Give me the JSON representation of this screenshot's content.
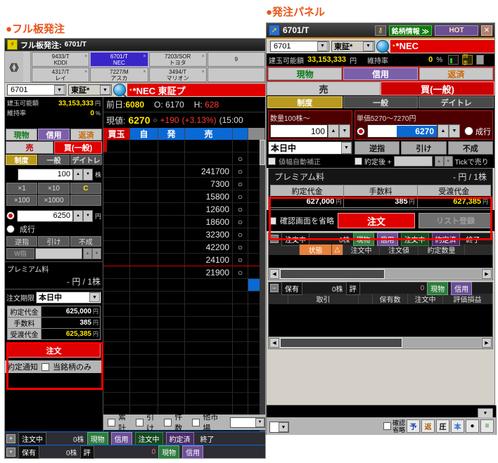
{
  "captions": {
    "left": "●フル板発注",
    "right": "●発注パネル"
  },
  "left_panel": {
    "titlebar": {
      "icon": "app-icon",
      "title": "フル板発注:",
      "symbol": "6701/T"
    },
    "tabs": [
      {
        "code": "9433/T",
        "name": "KDDI",
        "selected": false
      },
      {
        "code": "6701/T",
        "name": "NEC",
        "selected": true
      },
      {
        "code": "7203/SOR",
        "name": "トヨタ",
        "selected": false
      },
      {
        "code": "9",
        "name": "",
        "selected": false
      },
      {
        "code": "4317/T",
        "name": "レイ",
        "selected": false
      },
      {
        "code": "7227/M",
        "name": "アスカ",
        "selected": false
      },
      {
        "code": "3494/T",
        "name": "マリオン",
        "selected": false
      },
      {
        "code": "",
        "name": "",
        "selected": false
      }
    ],
    "nav": {
      "prev": "《",
      "next": "》"
    },
    "symbol_row": {
      "code_value": "6701",
      "market_value": "東証*",
      "name_band": "*NEC 東証プ"
    },
    "account": {
      "margin_label": "建玉可能額",
      "margin_value": "33,153,333",
      "margin_unit": "円",
      "ratio_label": "維持率",
      "ratio_value": "0",
      "ratio_unit": "%"
    },
    "quote": {
      "prev_label": "前日:",
      "prev_value": "6080",
      "open_label": "O:",
      "open_value": "6170",
      "high_label": "H:",
      "high_value": "628",
      "cur_label": "現値:",
      "cur_value": "6270",
      "mark": "○",
      "change": "+190",
      "change_pct": "(+3.13%)",
      "time": "(15:00"
    },
    "order": {
      "seg_product": [
        "現物",
        "信用",
        "返済"
      ],
      "seg_side": [
        "売",
        "買(一般)"
      ],
      "seg_type": [
        "制度",
        "一般",
        "デイトレ"
      ],
      "qty_value": "100",
      "qty_unit": "株",
      "mult_buttons": [
        "×1",
        "×10",
        "C",
        "×100",
        "×1000",
        ""
      ],
      "price_value": "6250",
      "price_unit": "円",
      "market_label": "成行",
      "cond_buttons": [
        "逆指",
        "引け",
        "不成"
      ],
      "w_label": "W指",
      "premium_label": "プレミアム料",
      "premium_value": "- 円 / 1株",
      "term_label": "注文期限",
      "term_value": "本日中",
      "summary": [
        {
          "key": "約定代金",
          "value": "625,000",
          "unit": "円",
          "highlight": false
        },
        {
          "key": "手数料",
          "value": "385",
          "unit": "円",
          "highlight": false
        },
        {
          "key": "受渡代金",
          "value": "625,385",
          "unit": "円",
          "highlight": true
        }
      ],
      "submit_label": "注文",
      "notify_label": "約定通知",
      "notify_option": "当銘柄のみ"
    },
    "board": {
      "headers": [
        "買玉",
        "自",
        "発",
        "売",
        "",
        ""
      ],
      "rows": [
        {
          "buy": "",
          "own": "",
          "sent": "",
          "sell": "",
          "price": "",
          "tail": ""
        },
        {
          "buy": "",
          "own": "",
          "sent": "",
          "sell": "",
          "price": "○",
          "tail": ""
        },
        {
          "buy": "",
          "own": "",
          "sent": "",
          "sell": "241700",
          "price": "○",
          "tail": ""
        },
        {
          "buy": "",
          "own": "",
          "sent": "",
          "sell": "7300",
          "price": "○",
          "tail": ""
        },
        {
          "buy": "",
          "own": "",
          "sent": "",
          "sell": "15800",
          "price": "○",
          "tail": ""
        },
        {
          "buy": "",
          "own": "",
          "sent": "",
          "sell": "12600",
          "price": "○",
          "tail": ""
        },
        {
          "buy": "",
          "own": "",
          "sent": "",
          "sell": "18600",
          "price": "○",
          "tail": ""
        },
        {
          "buy": "",
          "own": "",
          "sent": "",
          "sell": "32300",
          "price": "○",
          "tail": ""
        },
        {
          "buy": "",
          "own": "",
          "sent": "",
          "sell": "42200",
          "price": "○",
          "tail": ""
        },
        {
          "buy": "",
          "own": "",
          "sent": "",
          "sell": "24100",
          "price": "○",
          "tail": ""
        },
        {
          "buy": "",
          "own": "",
          "sent": "",
          "sell": "21900",
          "price": "○",
          "tail": "·"
        },
        {
          "buy": "",
          "own": "",
          "sent": "",
          "sell": "",
          "price": "",
          "tail": ""
        },
        {
          "buy": "",
          "own": "",
          "sent": "",
          "sell": "",
          "price": "",
          "tail": ""
        },
        {
          "buy": "",
          "own": "",
          "sent": "",
          "sell": "",
          "price": "",
          "tail": ""
        },
        {
          "buy": "",
          "own": "",
          "sent": "",
          "sell": "",
          "price": "",
          "tail": ""
        },
        {
          "buy": "",
          "own": "",
          "sent": "",
          "sell": "",
          "price": "",
          "tail": ""
        },
        {
          "buy": "",
          "own": "",
          "sent": "",
          "sell": "",
          "price": "",
          "tail": ""
        },
        {
          "buy": "",
          "own": "",
          "sent": "",
          "sell": "",
          "price": "",
          "tail": ""
        },
        {
          "buy": "",
          "own": "",
          "sent": "",
          "sell": "",
          "price": "",
          "tail": ""
        },
        {
          "buy": "",
          "own": "",
          "sent": "",
          "sell": "",
          "price": "",
          "tail": ""
        },
        {
          "buy": "",
          "own": "",
          "sent": "",
          "sell": "",
          "price": "",
          "tail": ""
        },
        {
          "buy": "",
          "own": "",
          "sent": "",
          "sell": "",
          "price": "",
          "tail": ""
        },
        {
          "buy": "",
          "own": "",
          "sent": "",
          "sell": "",
          "price": "",
          "tail": ""
        },
        {
          "buy": "",
          "own": "",
          "sent": "",
          "sell": "",
          "price": "",
          "tail": ""
        },
        {
          "buy": "",
          "own": "",
          "sent": "",
          "sell": "",
          "price": "",
          "tail": ""
        }
      ],
      "separator_after_row": 9
    },
    "footer_options": [
      {
        "label": "累計"
      },
      {
        "label": "引け"
      },
      {
        "label": "件数"
      },
      {
        "label": "他市場"
      }
    ],
    "footer_select_value": "",
    "status_orders": {
      "expand": "+",
      "label": "注文中",
      "count": "0株",
      "chips": [
        "現物",
        "信用",
        "注文中",
        "約定済",
        "終了"
      ]
    },
    "status_holdings": {
      "expand": "+",
      "label": "保有",
      "count": "0株",
      "eval_label": "評",
      "eval_value": "0",
      "chips": [
        "現物",
        "信用"
      ]
    }
  },
  "right_panel": {
    "titlebar": {
      "symbol": "6701/T",
      "key_icon": "key-icon",
      "info_button": "銘柄情報 ≫",
      "hot_button": "HOT",
      "close_button": "✕"
    },
    "symbol_row": {
      "code_value": "6701",
      "market_value": "東証*",
      "name_band": "*NEC"
    },
    "account": {
      "margin_label": "建玉可能額",
      "margin_value": "33,153,333",
      "margin_unit": "円",
      "ratio_label": "維持率",
      "ratio_value": "0",
      "ratio_unit": "%"
    },
    "seg_product": [
      "現物",
      "信用",
      "返済"
    ],
    "seg_side": [
      "売",
      "買(一般)"
    ],
    "seg_type": [
      "制度",
      "一般",
      "デイトレ"
    ],
    "quantity": {
      "label": "数量",
      "hint": "100株～",
      "value": "100"
    },
    "price": {
      "label": "単価",
      "hint": "5270～7270円",
      "value": "6270",
      "market_label": "成行"
    },
    "term_value": "本日中",
    "cond_buttons": [
      "逆指",
      "引け",
      "不成"
    ],
    "auto_correct_label": "値幅自動補正",
    "after_fill_label": "約定後 +",
    "tick_label": "Tickで売り",
    "premium": {
      "label": "プレミアム料",
      "value": "- 円 / 1株",
      "headers": [
        "約定代金",
        "手数料",
        "受渡代金"
      ],
      "values": [
        "627,000",
        "385",
        "627,385"
      ],
      "unit": "円"
    },
    "action": {
      "skip_confirm_label": "確認画面を省略",
      "order_button": "注文",
      "list_button": "リスト登録"
    },
    "orders_section": {
      "label": "注文中",
      "count": "0株",
      "chips": [
        "現物",
        "信用",
        "注文中",
        "約定済",
        "終了"
      ],
      "columns": [
        "状態",
        "△",
        "注文中",
        "注文値",
        "約定数量"
      ]
    },
    "holdings_section": {
      "label": "保有",
      "count": "0株",
      "eval_label": "評",
      "eval_value": "0",
      "chips": [
        "現物",
        "信用"
      ],
      "columns": [
        "取引",
        "保有数",
        "注文中",
        "評価損益"
      ]
    },
    "bottom_bar": {
      "skip_label_1": "確認",
      "skip_label_2": "省略",
      "tools": [
        "予",
        "返",
        "圧",
        "本",
        "●",
        "≡"
      ]
    }
  },
  "colors": {
    "accent_caption": "#e8541a",
    "buy_red": "#e00000",
    "sell_blue": "#0b69d4",
    "highlight_yellow": "#ffe600",
    "frame_red": "#ff0000"
  }
}
